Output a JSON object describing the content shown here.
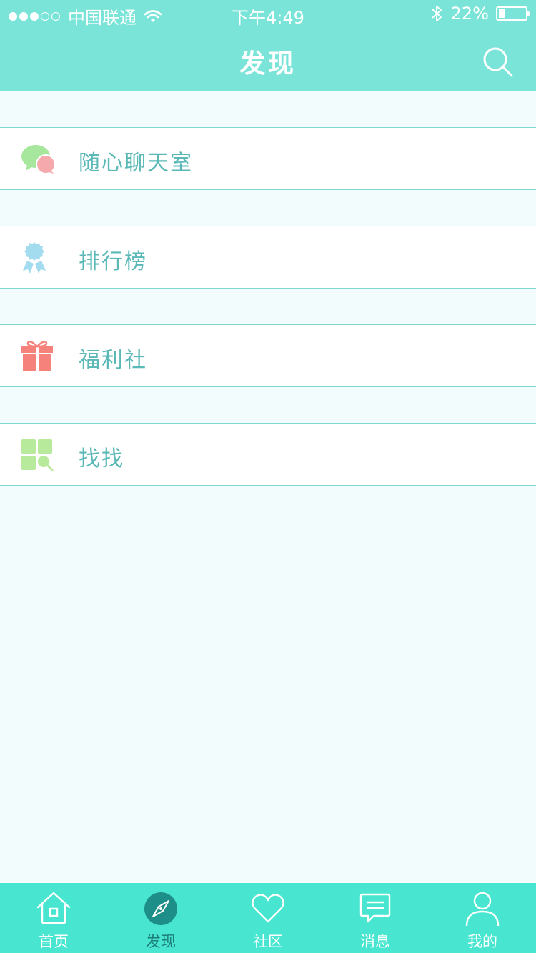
{
  "status_bar": {
    "carrier": "中国联通",
    "time": "下午4:49",
    "battery": "22%",
    "battery_level": 0.22,
    "signal_bars": 3,
    "signal_total": 5
  },
  "nav": {
    "title": "发现",
    "search_icon": "search-icon"
  },
  "menu": [
    {
      "label": "随心聊天室",
      "icon": "chat-bubbles-icon"
    },
    {
      "label": "排行榜",
      "icon": "ribbon-badge-icon"
    },
    {
      "label": "福利社",
      "icon": "gift-icon"
    },
    {
      "label": "找找",
      "icon": "grid-search-icon"
    }
  ],
  "tabs": [
    {
      "label": "首页",
      "icon": "home-icon",
      "active": false
    },
    {
      "label": "发现",
      "icon": "compass-icon",
      "active": true
    },
    {
      "label": "社区",
      "icon": "heart-icon",
      "active": false
    },
    {
      "label": "消息",
      "icon": "message-icon",
      "active": false
    },
    {
      "label": "我的",
      "icon": "user-icon",
      "active": false
    }
  ],
  "colors": {
    "header": "#79e4d7",
    "tab_bar": "#48e6d0",
    "label_text": "#5ab8b6",
    "divider": "#7ed8cf",
    "background": "#f3fcfd",
    "active_tab": "#1e7f79"
  }
}
